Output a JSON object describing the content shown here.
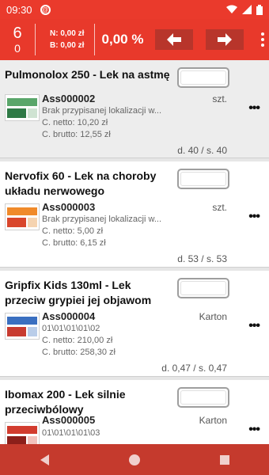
{
  "status_bar": {
    "time": "09:30",
    "icons": [
      "at-sign-icon",
      "wifi-icon",
      "signal-icon",
      "battery-icon"
    ]
  },
  "toolbar": {
    "count_top": "6",
    "count_bottom": "0",
    "netto": "N: 0,00 zł",
    "brutto": "B: 0,00 zł",
    "percent": "0,00 %",
    "accent_color": "#e8392b",
    "button_color": "#b8352b"
  },
  "products": [
    {
      "name": "Pulmonolox 250 - Lek na astmę",
      "code": "Ass000002",
      "unit": "szt.",
      "info": "Brak przypisanej lokalizacji w...",
      "price_netto": "C. netto: 10,20 zł",
      "price_brutto": "C. brutto: 12,55 zł",
      "stock": "d. 40 / s. 40"
    },
    {
      "name": "Nervofix 60 - Lek na choroby układu nerwowego",
      "code": "Ass000003",
      "unit": "szt.",
      "info": "Brak przypisanej lokalizacji w...",
      "price_netto": "C. netto: 5,00 zł",
      "price_brutto": "C. brutto: 6,15 zł",
      "stock": "d. 53 / s. 53"
    },
    {
      "name": "Gripfix Kids 130ml - Lek przeciw grypiei jej objawom",
      "code": "Ass000004",
      "unit": "Karton",
      "info": "01\\01\\01\\01\\02",
      "price_netto": "C. netto: 210,00 zł",
      "price_brutto": "C. brutto: 258,30 zł",
      "stock": "d. 0,47 / s. 0,47"
    },
    {
      "name": "Ibomax 200 - Lek silnie przeciwbólowy",
      "code": "Ass000005",
      "unit": "Karton",
      "info": "01\\01\\01\\01\\03",
      "price_netto": "",
      "price_brutto": "",
      "stock": ""
    }
  ],
  "more_label": "•••"
}
